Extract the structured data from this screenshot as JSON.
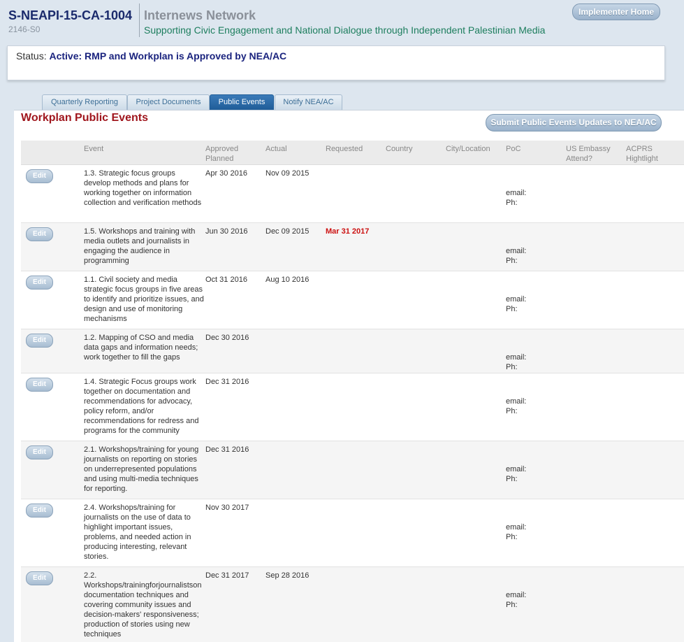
{
  "header": {
    "award_id": "S-NEAPI-15-CA-1004",
    "award_sub": "2146-S0",
    "org_name": "Internews Network",
    "org_desc": "Supporting Civic Engagement and National Dialogue through Independent Palestinian Media",
    "home_button": "Implementer Home"
  },
  "status": {
    "label": "Status:",
    "value": "Active: RMP and Workplan is Approved by NEA/AC"
  },
  "tabs": [
    {
      "label": "Quarterly Reporting",
      "active": false
    },
    {
      "label": "Project Documents",
      "active": false
    },
    {
      "label": "Public Events",
      "active": true
    },
    {
      "label": "Notify NEA/AC",
      "active": false
    }
  ],
  "panel": {
    "title": "Workplan Public Events",
    "submit_button": "Submit Public Events Updates to NEA/AC"
  },
  "columns": {
    "event": "Event",
    "approved": "Approved",
    "planned": "Planned",
    "actual": "Actual",
    "requested": "Requested",
    "country": "Country",
    "city": "City/Location",
    "poc": "PoC",
    "embassy1": "US Embassy",
    "embassy2": "Attend?",
    "acprs1": "ACPRS",
    "acprs2": "Hightlight"
  },
  "edit_label": "Edit",
  "poc_email": "email:",
  "poc_phone": "Ph:",
  "rows": [
    {
      "event": "1.3. Strategic focus groups develop methods and plans for working together on information collection and verification methods",
      "planned": "Apr 30 2016",
      "actual": "Nov 09 2015",
      "requested": ""
    },
    {
      "event": "1.5. Workshops and training with media outlets and journalists in engaging the audience in programming",
      "planned": "Jun 30 2016",
      "actual": "Dec 09 2015",
      "requested": "Mar 31 2017"
    },
    {
      "event": "1.1. Civil society and media strategic focus groups in five areas to identify and prioritize issues, and design and use of monitoring mechanisms",
      "planned": "Oct 31 2016",
      "actual": "Aug 10 2016",
      "requested": ""
    },
    {
      "event": "1.2. Mapping of CSO and media data gaps and information needs; work together to fill the gaps",
      "planned": "Dec 30 2016",
      "actual": "",
      "requested": ""
    },
    {
      "event": "1.4. Strategic Focus groups work together on documentation and recommendations for advocacy, policy reform, and/or recommendations for redress and programs for the community",
      "planned": "Dec 31 2016",
      "actual": "",
      "requested": ""
    },
    {
      "event": "2.1. Workshops/training for young journalists on reporting on stories on underrepresented populations and using multi-media techniques for reporting.",
      "planned": "Dec 31 2016",
      "actual": "",
      "requested": ""
    },
    {
      "event": "2.4. Workshops/training for journalists on the use of data to highlight important issues, problems, and needed action in producing interesting, relevant stories.",
      "planned": "Nov 30 2017",
      "actual": "",
      "requested": ""
    },
    {
      "event": "2.2. Workshops/trainingforjournalistson documentation techniques and covering community issues and decision-makers' responsiveness; production of stories using new techniques",
      "planned": "Dec 31 2017",
      "actual": "Sep 28 2016",
      "requested": ""
    }
  ]
}
